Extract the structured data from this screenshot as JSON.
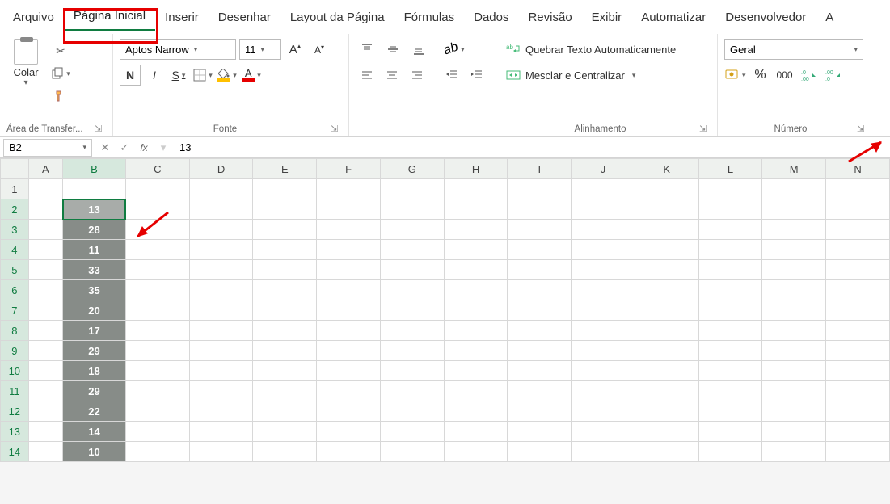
{
  "tabs": [
    "Arquivo",
    "Página Inicial",
    "Inserir",
    "Desenhar",
    "Layout da Página",
    "Fórmulas",
    "Dados",
    "Revisão",
    "Exibir",
    "Automatizar",
    "Desenvolvedor",
    "A"
  ],
  "active_tab": "Página Inicial",
  "clipboard": {
    "paste": "Colar",
    "group": "Área de Transfer..."
  },
  "font": {
    "name": "Aptos Narrow",
    "size": "11",
    "group": "Fonte",
    "bold": "N",
    "italic": "I",
    "underline": "S"
  },
  "alignment": {
    "wrap": "Quebrar Texto Automaticamente",
    "merge": "Mesclar e Centralizar",
    "group": "Alinhamento"
  },
  "number": {
    "format": "Geral",
    "group": "Número",
    "thousand": "000"
  },
  "namebox": "B2",
  "formula": "13",
  "columns": [
    "A",
    "B",
    "C",
    "D",
    "E",
    "F",
    "G",
    "H",
    "I",
    "J",
    "K",
    "L",
    "M",
    "N"
  ],
  "rows": [
    "1",
    "2",
    "3",
    "4",
    "5",
    "6",
    "7",
    "8",
    "9",
    "10",
    "11",
    "12",
    "13",
    "14"
  ],
  "data_b": [
    "13",
    "28",
    "11",
    "33",
    "35",
    "20",
    "17",
    "29",
    "18",
    "29",
    "22",
    "14",
    "10"
  ],
  "chart_data": {
    "type": "table",
    "title": "Column B selected values",
    "categories": [
      "B2",
      "B3",
      "B4",
      "B5",
      "B6",
      "B7",
      "B8",
      "B9",
      "B10",
      "B11",
      "B12",
      "B13",
      "B14"
    ],
    "values": [
      13,
      28,
      11,
      33,
      35,
      20,
      17,
      29,
      18,
      29,
      22,
      14,
      10
    ]
  }
}
